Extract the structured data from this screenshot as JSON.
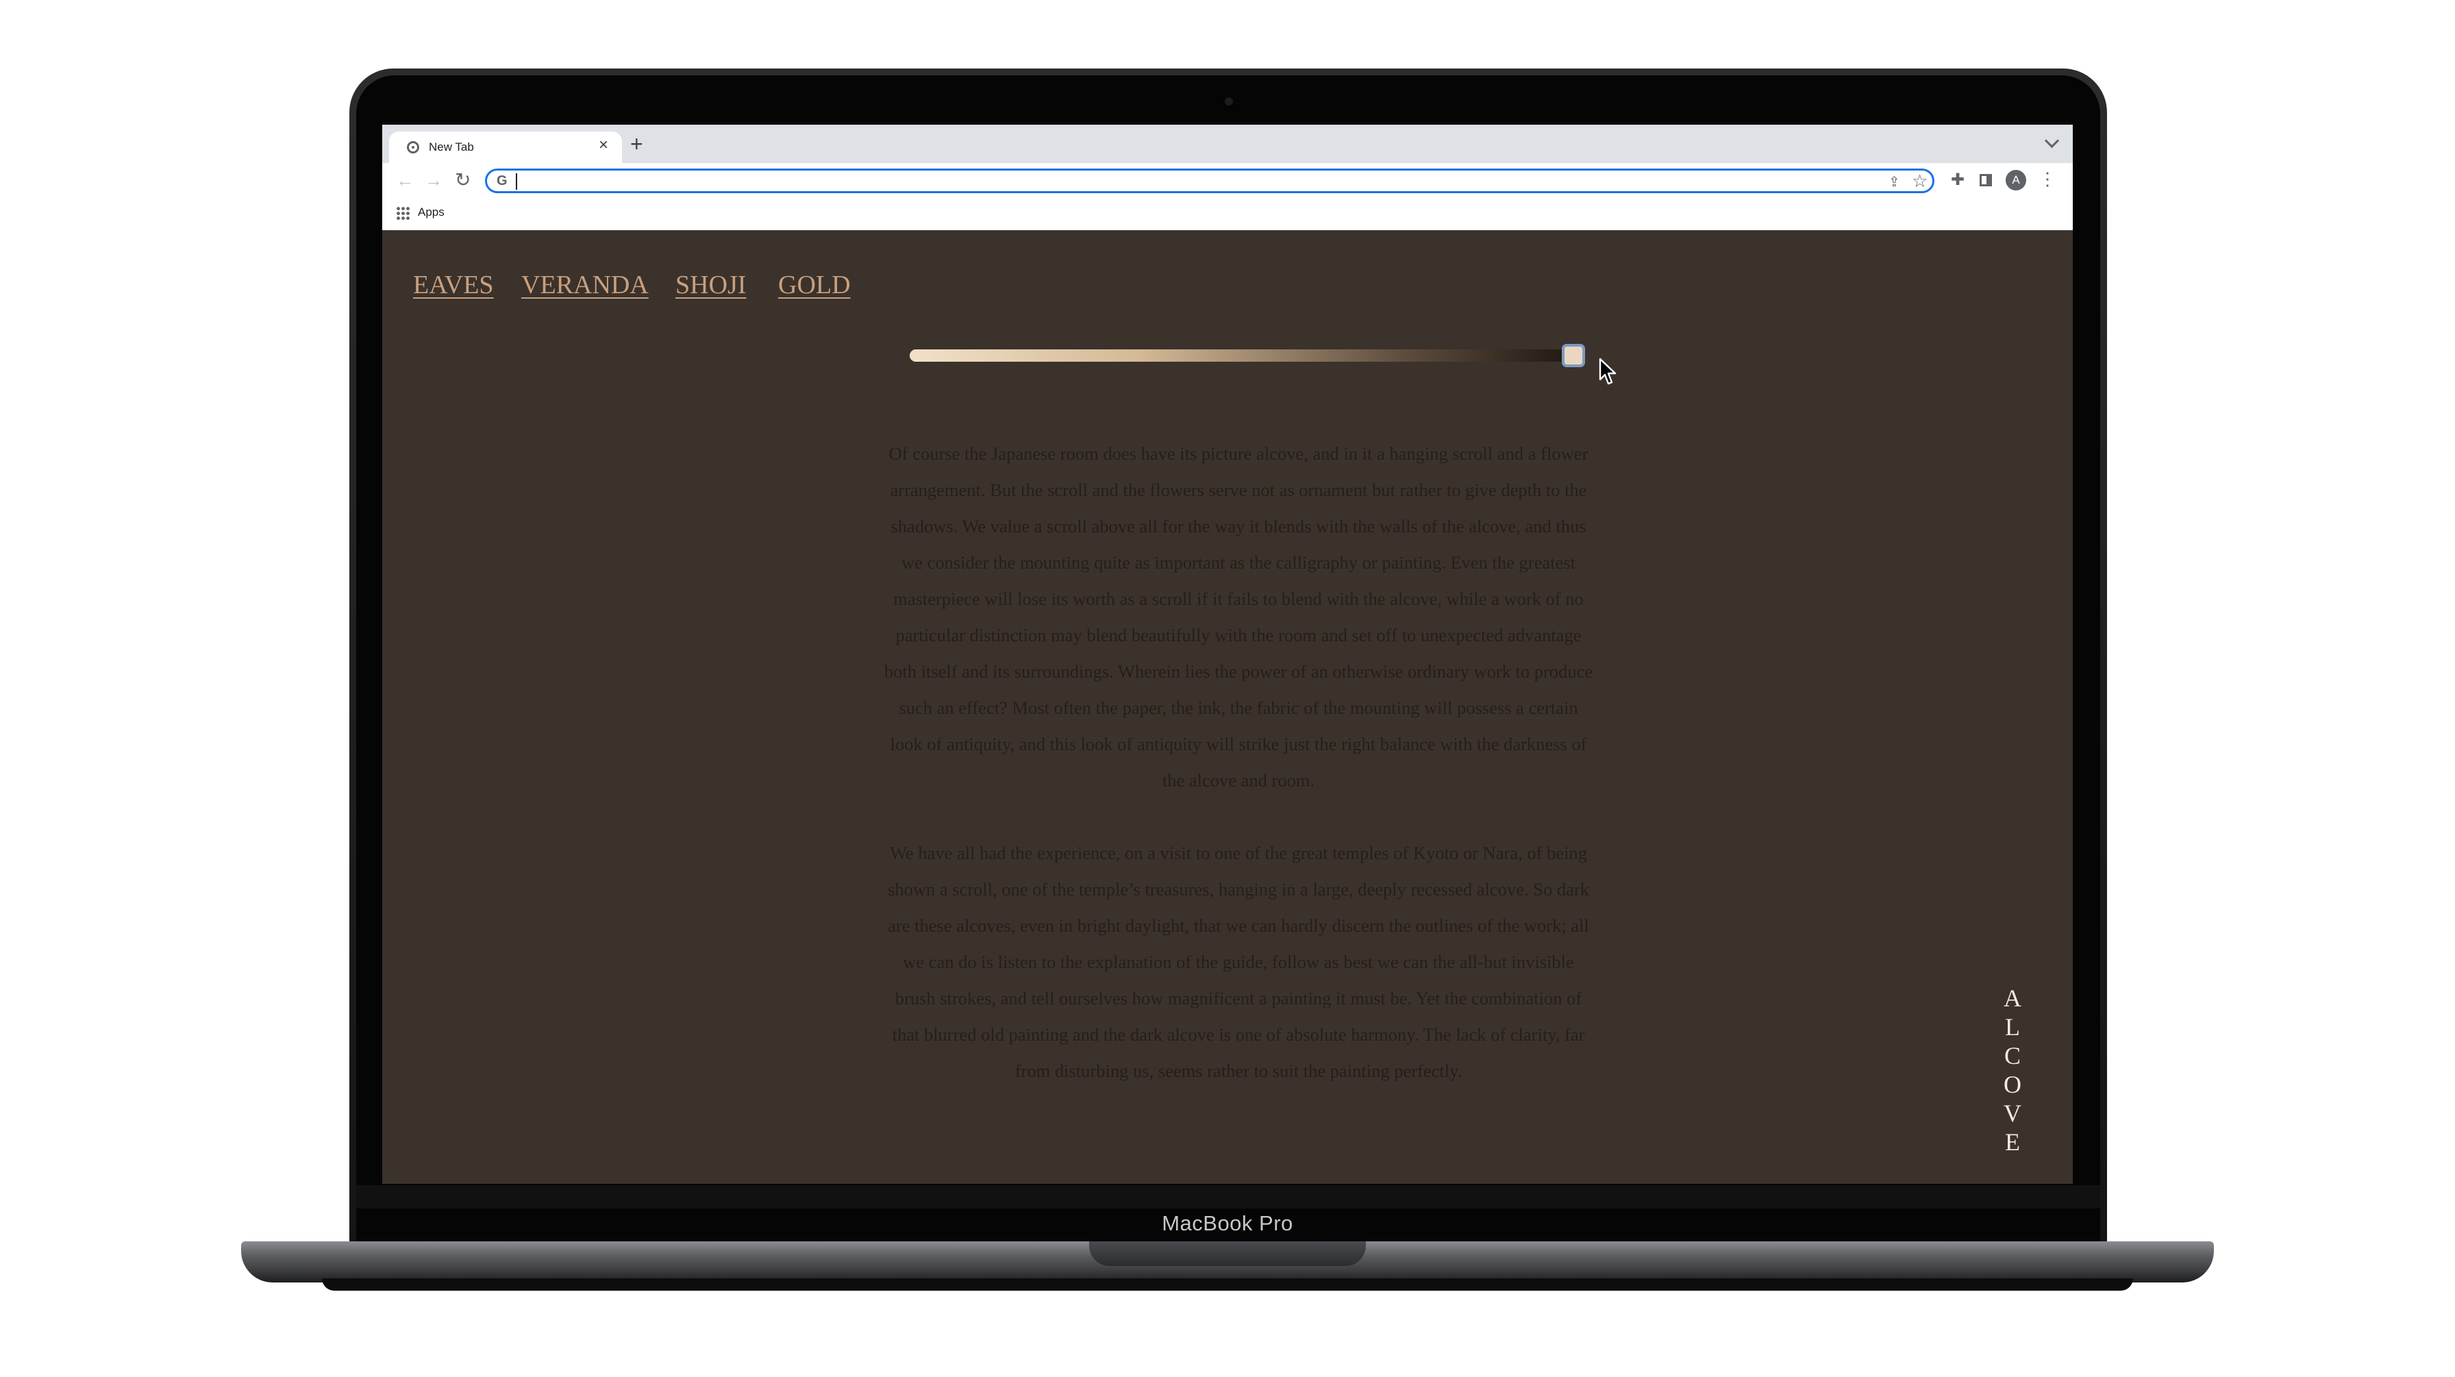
{
  "device": {
    "label": "MacBook Pro"
  },
  "browser": {
    "tab_title": "New Tab",
    "tab_close": "×",
    "new_tab": "+",
    "omnibox_value": "",
    "bookmarks": [
      {
        "label": "Apps",
        "icon": "apps-grid-icon"
      }
    ],
    "profile_initial": "A"
  },
  "site": {
    "nav": [
      {
        "label": "EAVES"
      },
      {
        "label": "VERANDA"
      },
      {
        "label": "SHOJI"
      },
      {
        "label": "GOLD"
      }
    ],
    "slider": {
      "value": 1.0,
      "min": 0,
      "max": 1
    },
    "paragraphs": [
      "Of course the Japanese room does have its picture alcove, and in it a hanging scroll and a flower arrangement. But the scroll and the flowers serve not as ornament but rather to give depth to the shadows. We value a scroll above all for the way it blends with the walls of the alcove, and thus we consider the mounting quite as important as the calligraphy or painting. Even the greatest masterpiece will lose its worth as a scroll if it fails to blend with the alcove, while a work of no particular distinction may blend beautifully with the room and set off to unexpected advantage both itself and its surroundings. Wherein lies the power of an otherwise ordinary work to produce such an effect? Most often the paper, the ink, the fabric of the mounting will possess a certain look of antiquity, and this look of antiquity will strike just the right balance with the darkness of the alcove and room.",
      "We have all had the experience, on a visit to one of the great temples of Kyoto or Nara, of being shown a scroll, one of the temple’s treasures, hanging in a large, deeply recessed alcove. So dark are these alcoves, even in bright daylight, that we can hardly discern the outlines of the work; all we can do is listen to the explanation of the guide, follow as best we can the all-but invisible brush strokes, and tell ourselves how magnificent a painting it must be. Yet the combination of that blurred old painting and the dark alcove is one of absolute harmony. The lack of clarity, far from disturbing us, seems rather to suit the painting perfectly."
    ],
    "section_title": "ALCOVE"
  },
  "colors": {
    "page_background": "#3b322c",
    "nav_link": "#c9a07e",
    "body_text": "#251e19",
    "section_title": "#f4ede5",
    "omnibox_focus": "#1a73e8"
  }
}
